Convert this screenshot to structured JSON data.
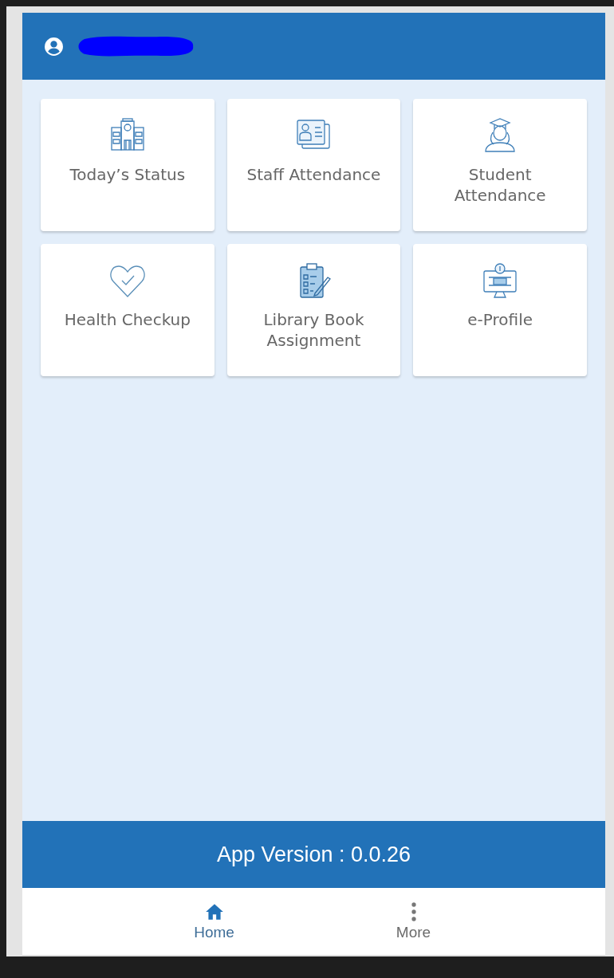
{
  "tiles": [
    {
      "label": "Today’s Status",
      "kind": "school"
    },
    {
      "label": "Staff Attendance",
      "kind": "idcard"
    },
    {
      "label": "Student Attendance",
      "kind": "student"
    },
    {
      "label": "Health Checkup",
      "kind": "heart"
    },
    {
      "label": "Library Book Assignment",
      "kind": "clipboard"
    },
    {
      "label": "e-Profile",
      "kind": "monitor"
    }
  ],
  "version_bar": "App Version : 0.0.26",
  "nav": [
    {
      "label": "Home",
      "kind": "home",
      "selected": true
    },
    {
      "label": "More",
      "kind": "more",
      "selected": false
    }
  ]
}
